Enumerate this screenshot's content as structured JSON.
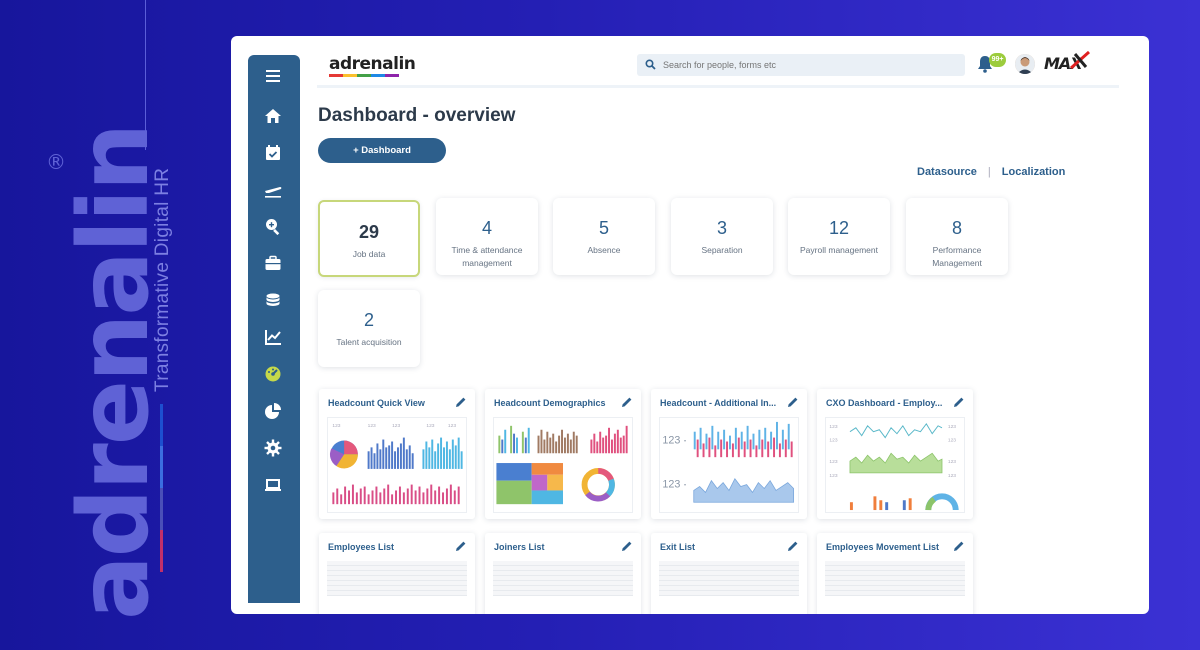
{
  "brand": {
    "name": "adrenalin",
    "registered": "®",
    "tagline": "Transformative Digital HR",
    "bar_colors": [
      "#1d4fd0",
      "#3b6ee0",
      "#4a4fb8",
      "#c0306a"
    ]
  },
  "header": {
    "logo": "adrenalin",
    "search_placeholder": "Search for people, forms etc",
    "notification_count": "99+",
    "company_logo": "MAX",
    "accent": "#9ccc3d"
  },
  "sidebar": {
    "color": "#2d5f8c",
    "items": [
      {
        "icon": "menu-icon"
      },
      {
        "icon": "home-icon"
      },
      {
        "icon": "calendar-check-icon"
      },
      {
        "icon": "plane-icon"
      },
      {
        "icon": "search-zoom-icon"
      },
      {
        "icon": "briefcase-icon"
      },
      {
        "icon": "coins-icon"
      },
      {
        "icon": "chart-line-icon"
      },
      {
        "icon": "dashboard-gauge-icon",
        "active": true
      },
      {
        "icon": "pie-chart-icon"
      },
      {
        "icon": "gear-icon"
      },
      {
        "icon": "laptop-icon"
      }
    ]
  },
  "main": {
    "title": "Dashboard - overview",
    "add_button": "+ Dashboard",
    "links": [
      "Datasource",
      "Localization"
    ],
    "link_separator": "|",
    "kpis": [
      {
        "value": "29",
        "label": "Job data",
        "active": true
      },
      {
        "value": "4",
        "label": "Time & attendance management"
      },
      {
        "value": "5",
        "label": "Absence"
      },
      {
        "value": "3",
        "label": "Separation"
      },
      {
        "value": "12",
        "label": "Payroll management"
      },
      {
        "value": "8",
        "label": "Performance Management"
      },
      {
        "value": "2",
        "label": "Talent acquisition"
      }
    ],
    "widgets": [
      {
        "title": "Headcount Quick View",
        "axis_tick": "123"
      },
      {
        "title": "Headcount Demographics"
      },
      {
        "title": "Headcount - Additional In...",
        "axis_tick": "123"
      },
      {
        "title": "CXO Dashboard - Employ...",
        "axis_tick": "123"
      },
      {
        "title": "Employees List"
      },
      {
        "title": "Joiners List"
      },
      {
        "title": "Exit List"
      },
      {
        "title": "Employees Movement List"
      }
    ]
  }
}
